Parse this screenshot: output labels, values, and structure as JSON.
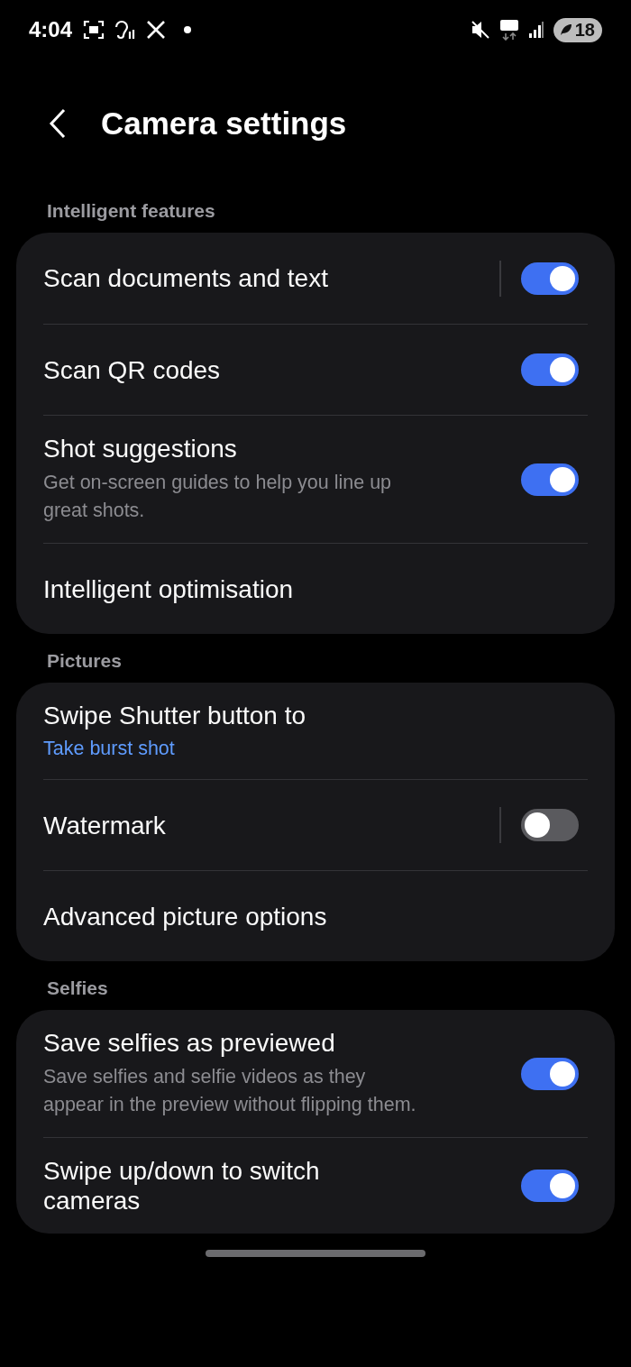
{
  "status_bar": {
    "time": "4:04",
    "battery": "18"
  },
  "header": {
    "title": "Camera settings"
  },
  "sections": [
    {
      "label": "Intelligent features",
      "items": [
        {
          "kind": "toggle",
          "title": "Scan documents and text",
          "split": true,
          "on": true
        },
        {
          "kind": "toggle",
          "title": "Scan QR codes",
          "split": false,
          "on": true
        },
        {
          "kind": "toggle",
          "title": "Shot suggestions",
          "subtitle": "Get on-screen guides to help you line up great shots.",
          "split": false,
          "on": true
        },
        {
          "kind": "link",
          "title": "Intelligent optimisation"
        }
      ]
    },
    {
      "label": "Pictures",
      "items": [
        {
          "kind": "value",
          "title": "Swipe Shutter button to",
          "value": "Take burst shot"
        },
        {
          "kind": "toggle",
          "title": "Watermark",
          "split": true,
          "on": false
        },
        {
          "kind": "link",
          "title": "Advanced picture options"
        }
      ]
    },
    {
      "label": "Selfies",
      "items": [
        {
          "kind": "toggle",
          "title": "Save selfies as previewed",
          "subtitle": "Save selfies and selfie videos as they appear in the preview without flipping them.",
          "split": false,
          "on": true
        },
        {
          "kind": "toggle",
          "title": "Swipe up/down to switch cameras",
          "split": false,
          "on": true
        }
      ]
    }
  ]
}
